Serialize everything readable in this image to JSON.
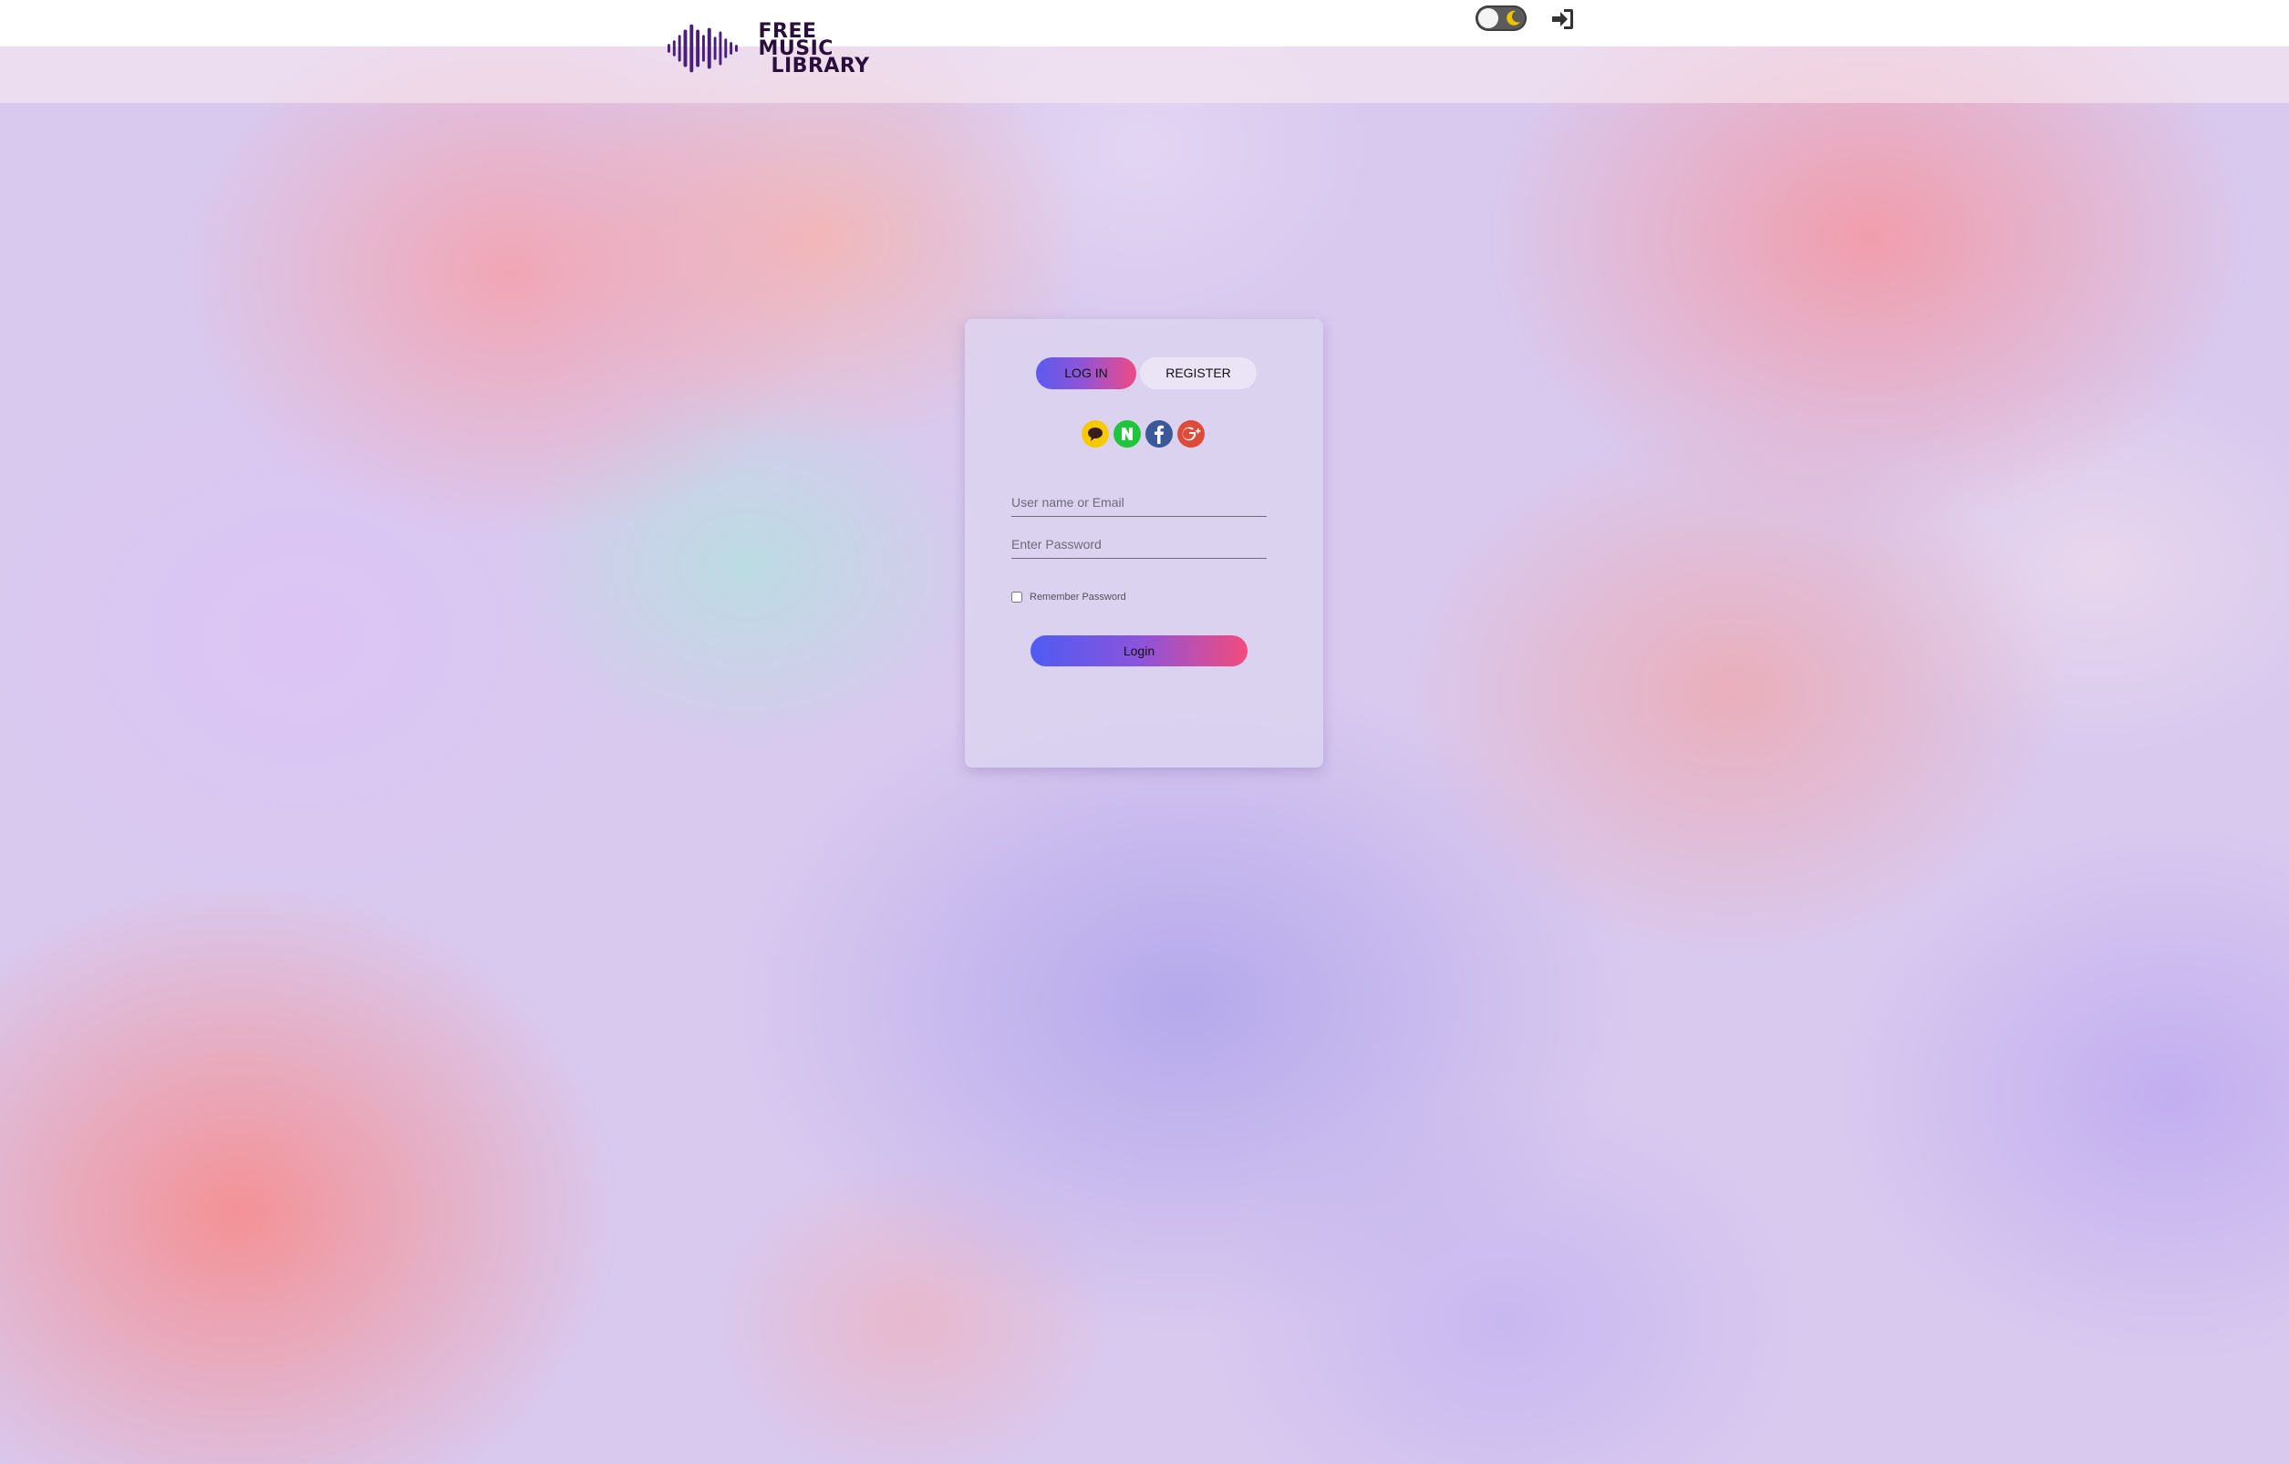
{
  "header": {
    "logo_line1": "FREE MUSIC",
    "logo_line2": "LIBRARY",
    "theme_toggle_icon": "moon-icon",
    "login_icon": "sign-in-icon"
  },
  "auth_card": {
    "tabs": [
      {
        "label": "LOG IN",
        "active": true
      },
      {
        "label": "REGISTER",
        "active": false
      }
    ],
    "social_logins": [
      {
        "name": "kakao",
        "icon": "kakao-icon",
        "color": "#f7c900"
      },
      {
        "name": "naver",
        "icon": "naver-icon",
        "color": "#1dc63a"
      },
      {
        "name": "facebook",
        "icon": "facebook-icon",
        "color": "#3b5998"
      },
      {
        "name": "google-plus",
        "icon": "google-plus-icon",
        "color": "#dd4b39"
      }
    ],
    "username_placeholder": "User name or Email",
    "password_placeholder": "Enter Password",
    "remember_label": "Remember Password",
    "remember_checked": false,
    "submit_label": "Login"
  },
  "colors": {
    "gradient_start": "#4e5cf3",
    "gradient_end": "#f34b7d"
  }
}
